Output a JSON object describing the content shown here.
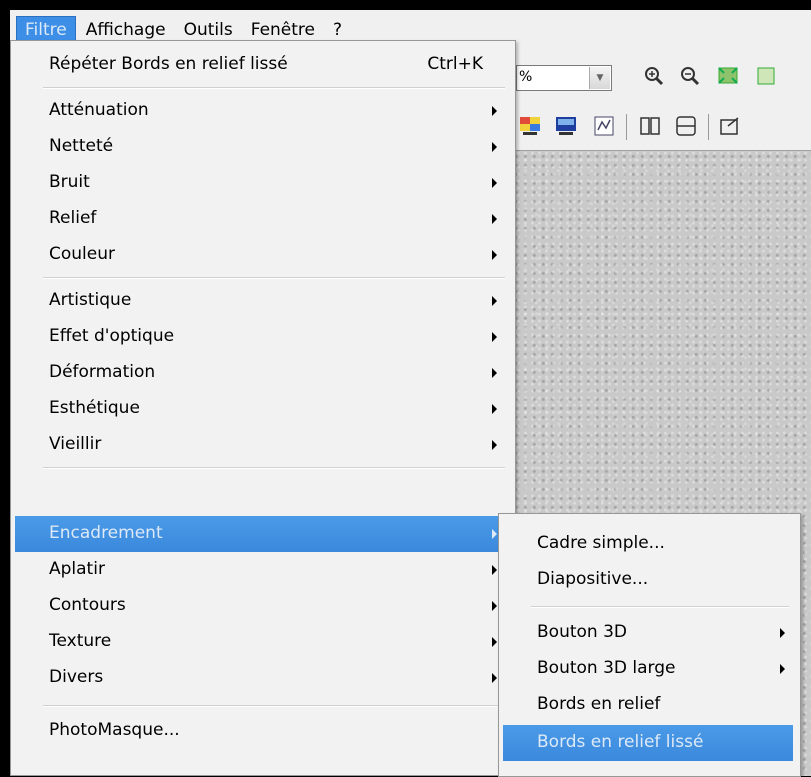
{
  "menubar": {
    "items": [
      {
        "label": "Filtre"
      },
      {
        "label": "Affichage"
      },
      {
        "label": "Outils"
      },
      {
        "label": "Fenêtre"
      },
      {
        "label": "?"
      }
    ]
  },
  "toolbar": {
    "zoom_value": "%",
    "icons": [
      "zoom-in-icon",
      "zoom-out-icon",
      "fit-image-icon",
      "palette-icon",
      "monitor-icon",
      "texture-icon",
      "book-icon",
      "scanner-icon",
      "export-icon"
    ]
  },
  "menu": {
    "repeat": {
      "label": "Répéter Bords en relief lissé",
      "shortcut": "Ctrl+K"
    },
    "group1": [
      "Atténuation",
      "Netteté",
      "Bruit",
      "Relief",
      "Couleur"
    ],
    "group2": [
      "Artistique",
      "Effet d'optique",
      "Déformation",
      "Esthétique",
      "Vieillir"
    ],
    "group3": [
      "Encadrement",
      "Aplatir",
      "Contours",
      "Texture",
      "Divers"
    ],
    "last": "PhotoMasque...",
    "highlighted": "Encadrement"
  },
  "submenu": {
    "items": [
      {
        "label": "Cadre simple...",
        "has_arrow": false
      },
      {
        "label": "Diapositive...",
        "has_arrow": false
      },
      {
        "label": "Bouton 3D",
        "has_arrow": true
      },
      {
        "label": "Bouton 3D large",
        "has_arrow": true
      },
      {
        "label": "Bords en relief",
        "has_arrow": false
      },
      {
        "label": "Bords en relief lissé",
        "has_arrow": false
      }
    ],
    "highlighted": "Bords en relief lissé"
  },
  "colors": {
    "highlight": "#3b88dc",
    "menu_bg": "#f2f2f2"
  }
}
